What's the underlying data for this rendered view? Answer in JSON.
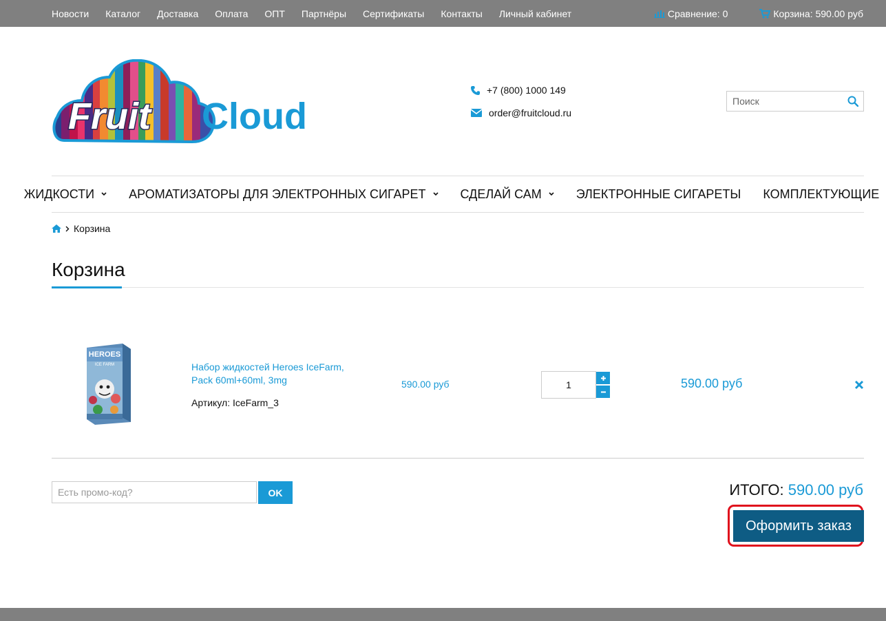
{
  "topbar": {
    "links": [
      "Новости",
      "Каталог",
      "Доставка",
      "Оплата",
      "ОПТ",
      "Партнёры",
      "Сертификаты",
      "Контакты",
      "Личный кабинет"
    ],
    "compare_label": "Сравнение: 0",
    "cart_label": "Корзина: 590.00 руб"
  },
  "header": {
    "logo_text_1": "Fruit",
    "logo_text_2": "Cloud",
    "phone": "+7 (800) 1000 149",
    "email": "order@fruitcloud.ru",
    "search_placeholder": "Поиск"
  },
  "mainnav": {
    "items": [
      {
        "label": "ЖИДКОСТИ",
        "dropdown": true
      },
      {
        "label": "АРОМАТИЗАТОРЫ ДЛЯ ЭЛЕКТРОННЫХ СИГАРЕТ",
        "dropdown": true
      },
      {
        "label": "СДЕЛАЙ САМ",
        "dropdown": true
      },
      {
        "label": "ЭЛЕКТРОННЫЕ СИГАРЕТЫ",
        "dropdown": false
      },
      {
        "label": "КОМПЛЕКТУЮЩИЕ",
        "dropdown": true
      }
    ]
  },
  "breadcrumb": {
    "current": "Корзина"
  },
  "page": {
    "title": "Корзина"
  },
  "cart": {
    "items": [
      {
        "name": "Набор жидкостей Heroes IceFarm, Pack 60ml+60ml, 3mg",
        "sku": "Артикул: IceFarm_3",
        "unit_price": "590.00 руб",
        "quantity": "1",
        "line_total": "590.00 руб",
        "image_text": "HEROES",
        "image_subtext": "ICE FARM"
      }
    ],
    "promo_placeholder": "Есть промо-код?",
    "promo_button": "OK",
    "total_label": "ИТОГО:",
    "total_value": "590.00 руб",
    "checkout_button": "Оформить заказ"
  },
  "colors": {
    "accent": "#1a9ad6",
    "checkout": "#0e5c84",
    "highlight": "#e0101c",
    "topbar": "#808080"
  }
}
